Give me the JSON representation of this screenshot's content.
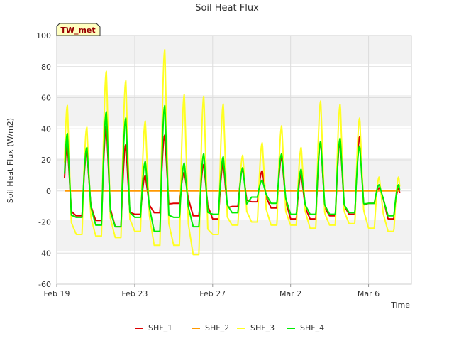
{
  "chart_data": {
    "type": "line",
    "title": "Soil Heat Flux",
    "xlabel": "Time",
    "ylabel": "Soil Heat Flux (W/m2)",
    "station_badge": "TW_met",
    "ylim": [
      -60,
      100
    ],
    "yticks": [
      -60,
      -40,
      -20,
      0,
      20,
      40,
      60,
      80,
      100
    ],
    "xlim_days": [
      0,
      18.2
    ],
    "xticks": [
      {
        "day": 0,
        "label": "Feb 19"
      },
      {
        "day": 4,
        "label": "Feb 23"
      },
      {
        "day": 8,
        "label": "Feb 27"
      },
      {
        "day": 12,
        "label": "Mar 2"
      },
      {
        "day": 16,
        "label": "Mar 6"
      }
    ],
    "grid": true,
    "legend_position": "bottom",
    "day_range": [
      0.4,
      17.6
    ],
    "series": [
      {
        "name": "SHF_1",
        "color": "#dd0000",
        "daily_min": [
          -22,
          -16,
          -19,
          -23,
          -15,
          -14,
          -8,
          -16,
          -18,
          -10,
          -7,
          -11,
          -18,
          -18,
          -16,
          -15,
          -8,
          -18
        ],
        "daily_max": [
          30,
          25,
          42,
          30,
          10,
          36,
          12,
          17,
          18,
          14,
          13,
          22,
          11,
          32,
          32,
          35,
          2
        ]
      },
      {
        "name": "SHF_2",
        "color": "#ff9900",
        "daily_min": [
          0
        ],
        "daily_max": [
          0
        ]
      },
      {
        "name": "SHF_3",
        "color": "#ffff22",
        "daily_min": [
          -34,
          -28,
          -29,
          -30,
          -26,
          -35,
          -35,
          -41,
          -28,
          -22,
          -20,
          -22,
          -22,
          -24,
          -22,
          -21,
          -24,
          -26
        ],
        "daily_max": [
          55,
          41,
          77,
          71,
          45,
          91,
          62,
          61,
          56,
          23,
          31,
          42,
          28,
          58,
          56,
          47,
          9
        ]
      },
      {
        "name": "SHF_4",
        "color": "#00ee00",
        "daily_min": [
          -26,
          -17,
          -22,
          -23,
          -17,
          -26,
          -17,
          -23,
          -15,
          -14,
          -4,
          -8,
          -15,
          -15,
          -15,
          -14,
          -8,
          -16
        ],
        "daily_max": [
          37,
          28,
          51,
          47,
          19,
          55,
          18,
          24,
          22,
          15,
          7,
          24,
          14,
          32,
          34,
          29,
          4
        ]
      }
    ]
  }
}
